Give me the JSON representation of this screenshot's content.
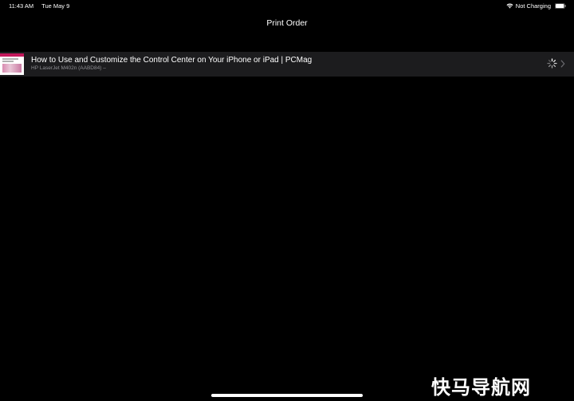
{
  "status_bar": {
    "time": "11:43 AM",
    "date": "Tue May 9",
    "charging_status": "Not Charging",
    "wifi_icon": "wifi-icon",
    "battery_icon": "battery-icon"
  },
  "nav": {
    "title": "Print Order"
  },
  "print_jobs": [
    {
      "title": "How to Use and Customize the Control Center on Your iPhone or iPad | PCMag",
      "subtitle": "HP LaserJet M402n (AABD84) –",
      "thumbnail_icon": "document-thumbnail",
      "status_icon": "spinner-icon",
      "accessory_icon": "chevron-right-icon"
    }
  ],
  "watermark": {
    "text": "快马导航网"
  },
  "colors": {
    "background": "#000000",
    "row_background": "#1c1c1e",
    "secondary_text": "#8e8e93",
    "thumbnail_accent": "#c2185b"
  }
}
